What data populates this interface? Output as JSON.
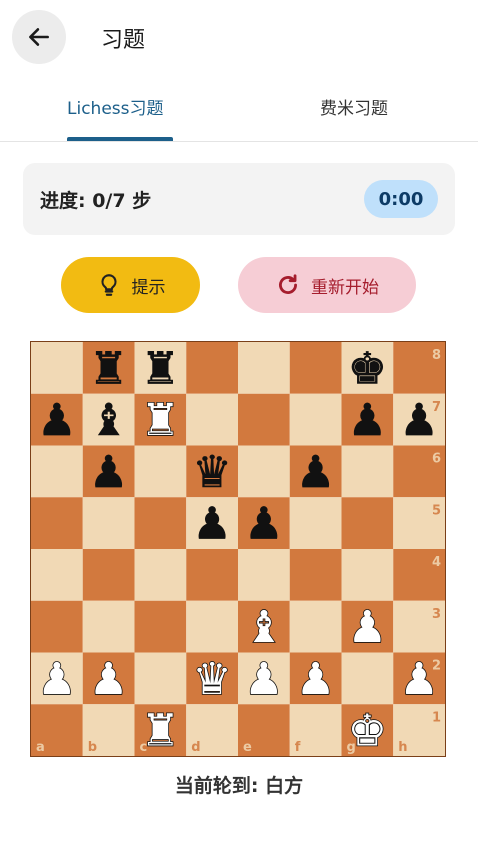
{
  "header": {
    "title": "习题"
  },
  "tabs": [
    {
      "label": "Lichess习题",
      "active": true
    },
    {
      "label": "费米习题",
      "active": false
    }
  ],
  "progress": {
    "label": "进度: 0/7 步",
    "timer": "0:00"
  },
  "buttons": {
    "hint": {
      "label": "提示",
      "icon": "lightbulb-icon"
    },
    "restart": {
      "label": "重新开始",
      "icon": "refresh-icon"
    }
  },
  "board": {
    "files": [
      "a",
      "b",
      "c",
      "d",
      "e",
      "f",
      "g",
      "h"
    ],
    "ranks": [
      "8",
      "7",
      "6",
      "5",
      "4",
      "3",
      "2",
      "1"
    ],
    "light_color": "#f1d9b5",
    "dark_color": "#d2793e",
    "pieces": [
      {
        "sq": "b8",
        "p": "bR"
      },
      {
        "sq": "c8",
        "p": "bR"
      },
      {
        "sq": "g8",
        "p": "bK"
      },
      {
        "sq": "a7",
        "p": "bP"
      },
      {
        "sq": "b7",
        "p": "bB"
      },
      {
        "sq": "c7",
        "p": "wR"
      },
      {
        "sq": "g7",
        "p": "bP"
      },
      {
        "sq": "h7",
        "p": "bP"
      },
      {
        "sq": "b6",
        "p": "bP"
      },
      {
        "sq": "d6",
        "p": "bQ"
      },
      {
        "sq": "f6",
        "p": "bP"
      },
      {
        "sq": "d5",
        "p": "bP"
      },
      {
        "sq": "e5",
        "p": "bP"
      },
      {
        "sq": "e3",
        "p": "wB"
      },
      {
        "sq": "g3",
        "p": "wP"
      },
      {
        "sq": "a2",
        "p": "wP"
      },
      {
        "sq": "b2",
        "p": "wP"
      },
      {
        "sq": "d2",
        "p": "wQ"
      },
      {
        "sq": "e2",
        "p": "wP"
      },
      {
        "sq": "f2",
        "p": "wP"
      },
      {
        "sq": "h2",
        "p": "wP"
      },
      {
        "sq": "c1",
        "p": "wR"
      },
      {
        "sq": "g1",
        "p": "wK"
      }
    ]
  },
  "turn": {
    "label": "当前轮到: 白方"
  }
}
